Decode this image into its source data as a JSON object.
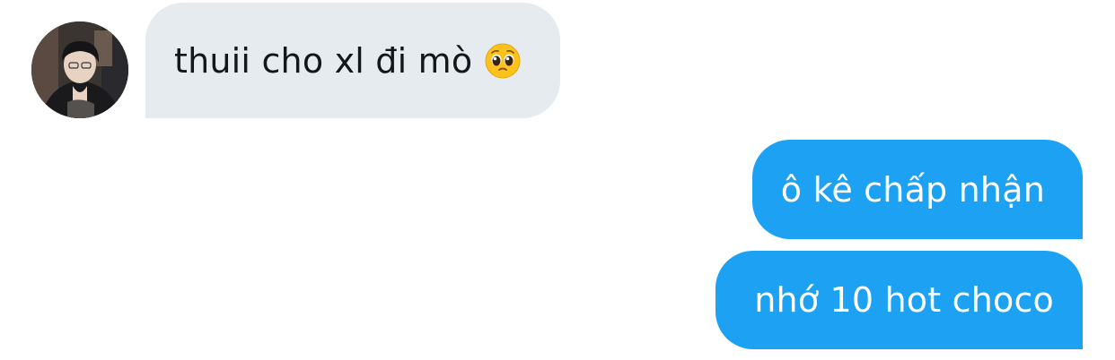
{
  "conversation": {
    "incoming": [
      {
        "text": "thuii cho xl đi mò",
        "emoji": "pleading-face-icon"
      }
    ],
    "outgoing": [
      {
        "text": "ô kê chấp nhận"
      },
      {
        "text": "nhớ 10 hot choco"
      }
    ]
  },
  "colors": {
    "incoming_bubble": "#e6ebef",
    "incoming_text": "#14171a",
    "outgoing_bubble": "#1da1f2",
    "outgoing_text": "#ffffff",
    "background": "#ffffff"
  }
}
